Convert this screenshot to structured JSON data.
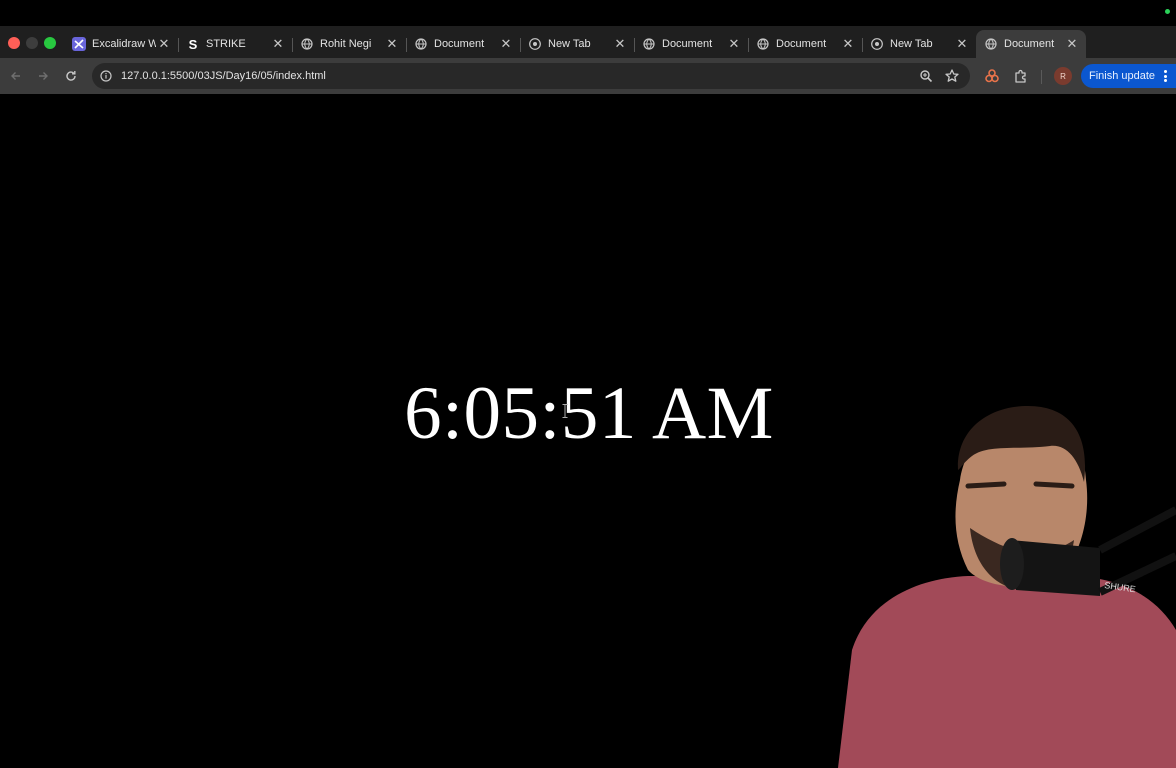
{
  "browser": {
    "tabs": [
      {
        "title": "Excalidraw W",
        "favicon": "excalidraw-icon",
        "active": false
      },
      {
        "title": "STRIKE",
        "favicon": "strike-icon",
        "active": false
      },
      {
        "title": "Rohit Negi",
        "favicon": "globe-icon",
        "active": false
      },
      {
        "title": "Document",
        "favicon": "globe-icon",
        "active": false
      },
      {
        "title": "New Tab",
        "favicon": "chrome-icon",
        "active": false
      },
      {
        "title": "Document",
        "favicon": "globe-icon",
        "active": false
      },
      {
        "title": "Document",
        "favicon": "globe-icon",
        "active": false
      },
      {
        "title": "New Tab",
        "favicon": "chrome-icon",
        "active": false
      },
      {
        "title": "Document",
        "favicon": "globe-icon",
        "active": true
      }
    ],
    "url": "127.0.0.1:5500/03JS/Day16/05/index.html",
    "profile_initial": "R",
    "update_button": "Finish update",
    "accent": "#0b57d0"
  },
  "page": {
    "clock_text": "6:05:51 AM",
    "background": "#000000",
    "text_color": "#ffffff"
  }
}
